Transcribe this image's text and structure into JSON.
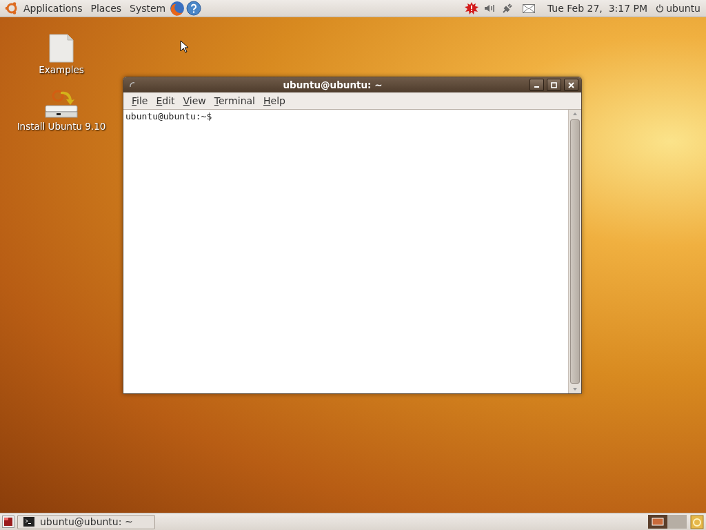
{
  "top_panel": {
    "menus": [
      "Applications",
      "Places",
      "System"
    ],
    "clock": "Tue Feb 27,  3:17 PM",
    "user": "ubuntu"
  },
  "desktop_icons": [
    {
      "kind": "file",
      "label": "Examples"
    },
    {
      "kind": "installer",
      "label": "Install Ubuntu 9.10"
    }
  ],
  "terminal": {
    "title": "ubuntu@ubuntu: ~",
    "menus": [
      "File",
      "Edit",
      "View",
      "Terminal",
      "Help"
    ],
    "prompt": "ubuntu@ubuntu:~$"
  },
  "bottom_panel": {
    "tasks": [
      {
        "label": "ubuntu@ubuntu: ~",
        "selected": false
      }
    ],
    "workspaces": [
      {
        "selected": true
      },
      {
        "selected": false
      }
    ]
  }
}
